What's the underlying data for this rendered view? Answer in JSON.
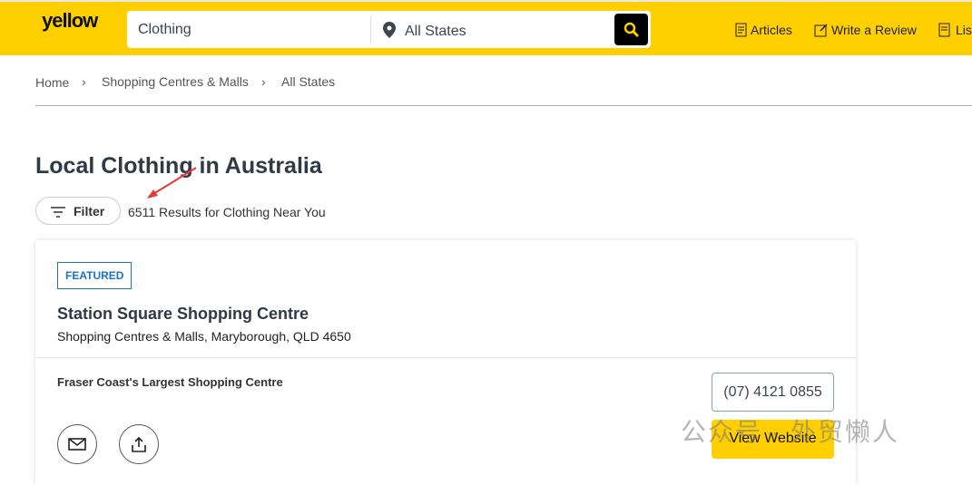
{
  "header": {
    "logo": "yellow",
    "search_query": "Clothing",
    "location": "All States",
    "nav": [
      {
        "label": "Articles",
        "icon": "articles-icon"
      },
      {
        "label": "Write a Review",
        "icon": "edit-icon"
      },
      {
        "label": "Lis",
        "icon": "listing-icon"
      }
    ]
  },
  "breadcrumb": [
    "Home",
    "Shopping Centres & Malls",
    "All States"
  ],
  "page_title": "Local Clothing in Australia",
  "filter_label": "Filter",
  "results_text": "6511 Results for Clothing Near You",
  "listing": {
    "badge": "FEATURED",
    "name": "Station Square Shopping Centre",
    "address": "Shopping Centres & Malls, Maryborough, QLD 4650",
    "tagline": "Fraser Coast's Largest Shopping Centre",
    "phone": "(07) 4121 0855",
    "website_label": "View Website"
  },
  "watermark": "公众号 · 外贸懒人",
  "colors": {
    "brand": "#ffcf00",
    "badge": "#1a73c8"
  }
}
